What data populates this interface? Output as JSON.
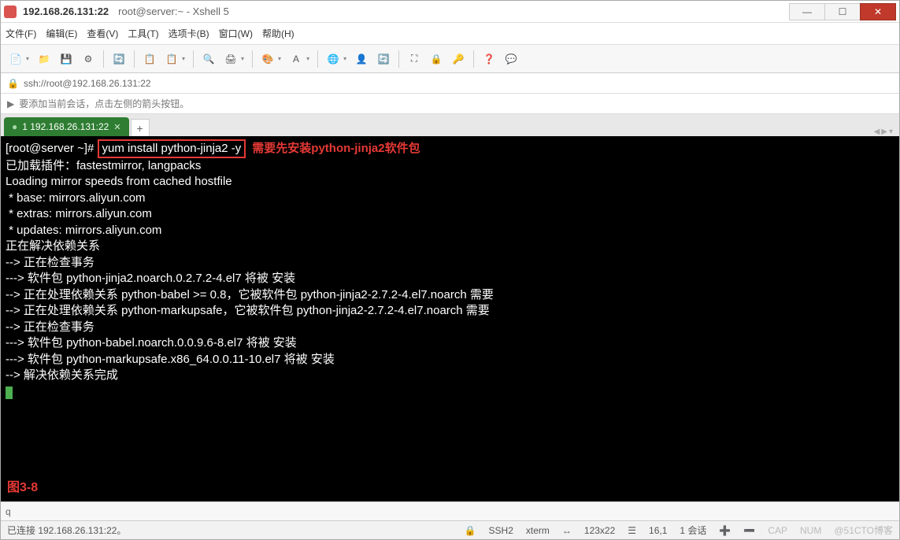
{
  "title": {
    "ip": "192.168.26.131:22",
    "label": "root@server:~ - Xshell 5"
  },
  "menu": {
    "file": "文件(F)",
    "edit": "编辑(E)",
    "view": "查看(V)",
    "tools": "工具(T)",
    "tabs": "选项卡(B)",
    "window": "窗口(W)",
    "help": "帮助(H)"
  },
  "address": {
    "url": "ssh://root@192.168.26.131:22"
  },
  "hint": {
    "text": "要添加当前会话，点击左侧的箭头按钮。"
  },
  "tab": {
    "label": "1 192.168.26.131:22",
    "plus": "+"
  },
  "term": {
    "prompt": "[root@server ~]# ",
    "cmd": "yum install python-jinja2 -y",
    "annot": "需要先安装python-jinja2软件包",
    "l1": "已加载插件：fastestmirror, langpacks",
    "l2": "Loading mirror speeds from cached hostfile",
    "l3": " * base: mirrors.aliyun.com",
    "l4": " * extras: mirrors.aliyun.com",
    "l5": " * updates: mirrors.aliyun.com",
    "l6": "正在解决依赖关系",
    "l7": "--> 正在检查事务",
    "l8": "---> 软件包 python-jinja2.noarch.0.2.7.2-4.el7 将被 安装",
    "l9": "--> 正在处理依赖关系 python-babel >= 0.8，它被软件包 python-jinja2-2.7.2-4.el7.noarch 需要",
    "l10": "--> 正在处理依赖关系 python-markupsafe，它被软件包 python-jinja2-2.7.2-4.el7.noarch 需要",
    "l11": "--> 正在检查事务",
    "l12": "---> 软件包 python-babel.noarch.0.0.9.6-8.el7 将被 安装",
    "l13": "---> 软件包 python-markupsafe.x86_64.0.0.11-10.el7 将被 安装",
    "l14": "--> 解决依赖关系完成",
    "figlabel": "图3-8"
  },
  "search": {
    "q": "q"
  },
  "status": {
    "conn": "已连接 192.168.26.131:22。",
    "proto": "SSH2",
    "termtype": "xterm",
    "size": "123x22",
    "pos": "16,1",
    "sessions": "1 会话",
    "caps": "CAP",
    "num": "NUM",
    "watermark": "@51CTO博客"
  },
  "icons": {
    "lock": "🔒",
    "arrow": "▶",
    "dot": "●",
    "new": "📄",
    "open": "📁",
    "save": "💾",
    "props": "⚙",
    "cut": "✂",
    "copy": "📋",
    "paste": "📋",
    "find": "🔍",
    "print": "🖨",
    "color": "🎨",
    "font": "A",
    "globe": "🌐",
    "user": "👤",
    "refresh": "🔄",
    "full": "⛶",
    "padlock": "🔒",
    "key": "🔑",
    "help": "❓",
    "chat": "💬",
    "proto_icon": "🔒",
    "size_icon": "↔",
    "pos_icon": "☰",
    "plus": "➕",
    "minus": "➖"
  }
}
